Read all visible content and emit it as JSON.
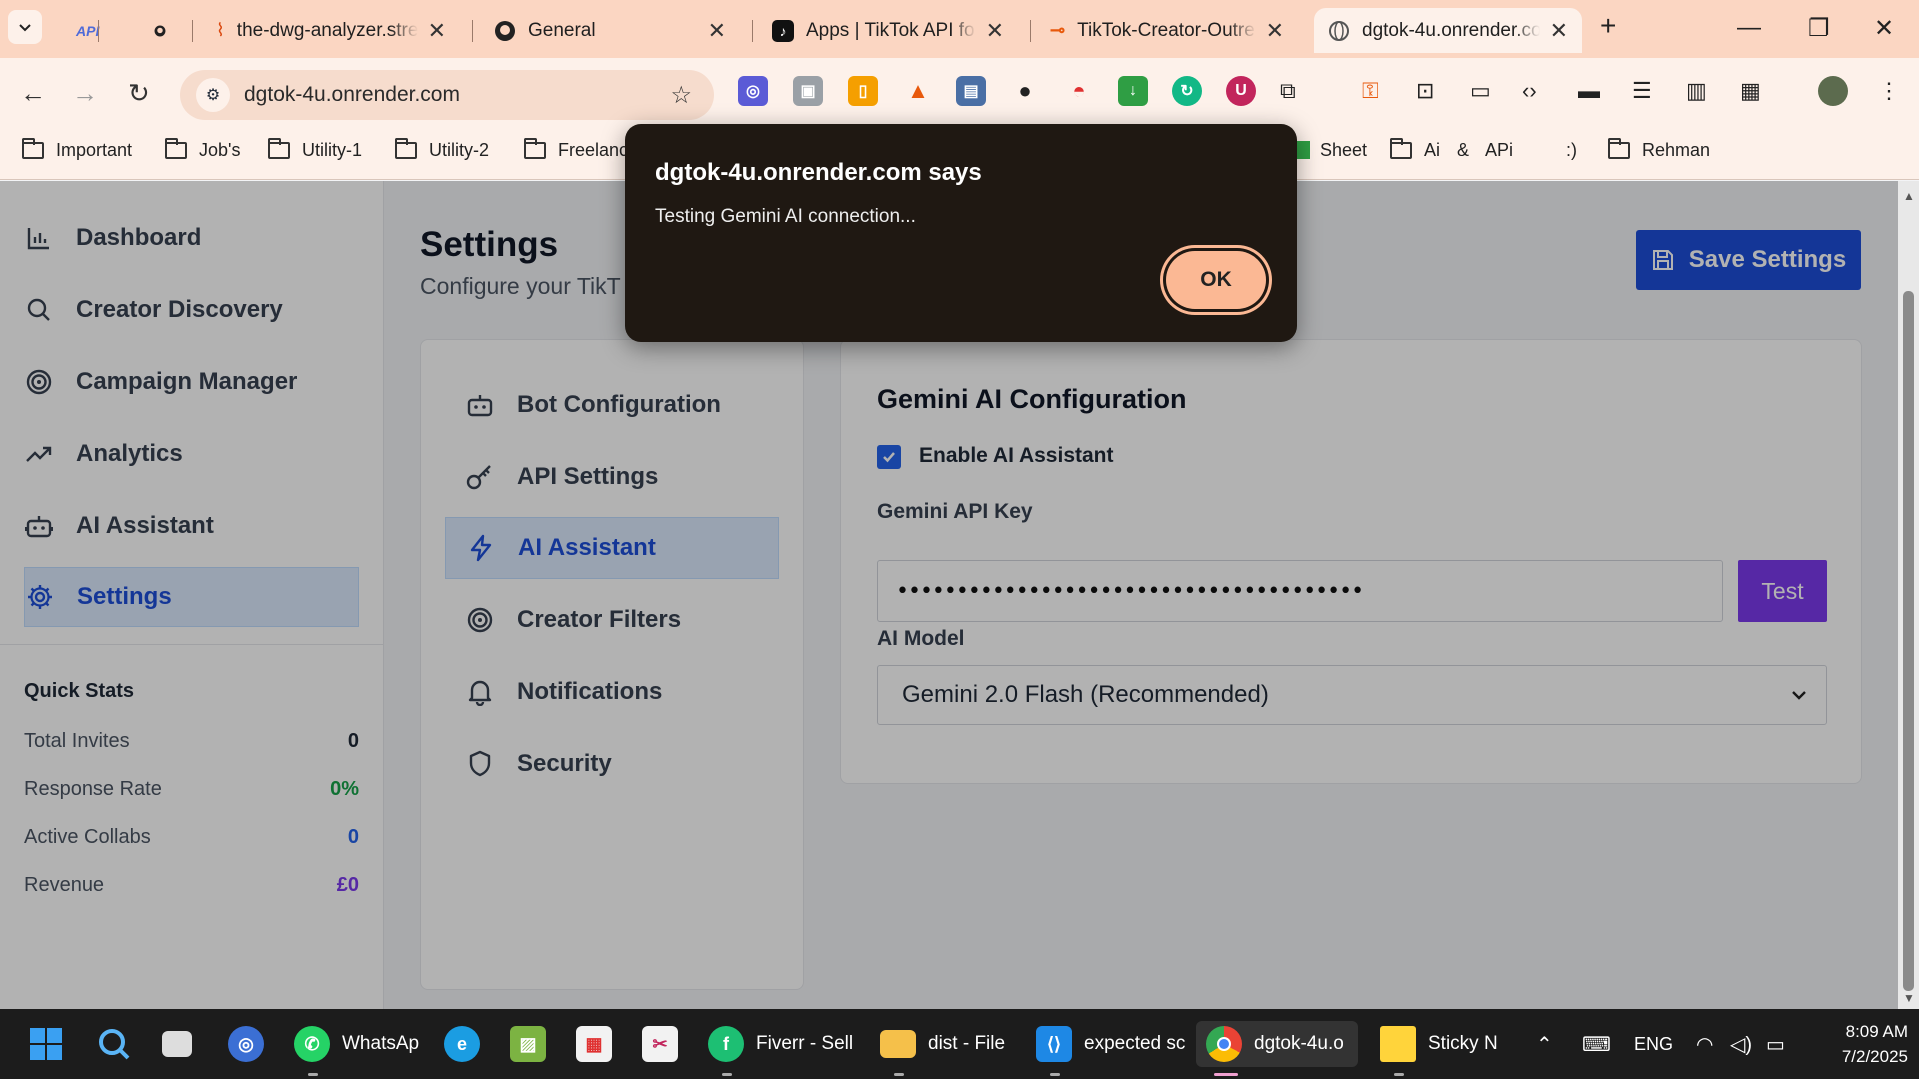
{
  "browser": {
    "tabs": [
      {
        "title": "API",
        "icon": "api-icon"
      },
      {
        "title": "",
        "icon": "github-icon"
      },
      {
        "title": "the-dwg-analyzer.stre",
        "icon": "streamlit-icon"
      },
      {
        "title": "General",
        "icon": "github-icon"
      },
      {
        "title": "Apps | TikTok API for |",
        "icon": "tiktok-icon"
      },
      {
        "title": "TikTok-Creator-Outre",
        "icon": "render-icon"
      },
      {
        "title": "dgtok-4u.onrender.co",
        "icon": "globe-icon"
      }
    ],
    "url": "dgtok-4u.onrender.com",
    "bookmarks": [
      "Important",
      "Job's",
      "Utility-1",
      "Utility-2",
      "Freelanc",
      "Sheet",
      "Ai & APi",
      ":)",
      "Rehman"
    ]
  },
  "sidebar": {
    "items": [
      {
        "label": "Dashboard",
        "icon": "bar-chart-icon"
      },
      {
        "label": "Creator Discovery",
        "icon": "search-icon"
      },
      {
        "label": "Campaign Manager",
        "icon": "target-icon"
      },
      {
        "label": "Analytics",
        "icon": "trending-up-icon"
      },
      {
        "label": "AI Assistant",
        "icon": "robot-icon"
      },
      {
        "label": "Settings",
        "icon": "gear-icon",
        "active": true
      }
    ],
    "quick_stats": {
      "title": "Quick Stats",
      "rows": [
        {
          "label": "Total Invites",
          "value": "0",
          "color": "#1f2937"
        },
        {
          "label": "Response Rate",
          "value": "0%",
          "color": "#16a34a"
        },
        {
          "label": "Active Collabs",
          "value": "0",
          "color": "#2563eb"
        },
        {
          "label": "Revenue",
          "value": "£0",
          "color": "#7c3aed"
        }
      ]
    }
  },
  "main": {
    "title": "Settings",
    "subtitle": "Configure your TikT",
    "save_label": "Save Settings"
  },
  "settings_nav": [
    {
      "label": "Bot Configuration",
      "icon": "robot-icon"
    },
    {
      "label": "API Settings",
      "icon": "key-icon"
    },
    {
      "label": "AI Assistant",
      "icon": "lightning-icon",
      "active": true
    },
    {
      "label": "Creator Filters",
      "icon": "target-icon"
    },
    {
      "label": "Notifications",
      "icon": "bell-icon"
    },
    {
      "label": "Security",
      "icon": "shield-icon"
    }
  ],
  "panel": {
    "title": "Gemini AI Configuration",
    "enable_label": "Enable AI Assistant",
    "enable_checked": true,
    "api_key_label": "Gemini API Key",
    "api_key_value": "•••••••••••••••••••••••••••••••••••••••",
    "test_label": "Test",
    "model_label": "AI Model",
    "model_value": "Gemini 2.0 Flash (Recommended)"
  },
  "dialog": {
    "title": "dgtok-4u.onrender.com says",
    "message": "Testing Gemini AI connection...",
    "ok_label": "OK"
  },
  "taskbar": {
    "apps": [
      {
        "label": "WhatsAp",
        "icon": "whatsapp-icon"
      },
      {
        "label": "Fiverr - Sell",
        "icon": "fiverr-icon"
      },
      {
        "label": "dist - File",
        "icon": "folder-icon"
      },
      {
        "label": "expected sc",
        "icon": "vscode-icon"
      },
      {
        "label": "dgtok-4u.o",
        "icon": "chrome-icon"
      },
      {
        "label": "Sticky N",
        "icon": "sticky-notes-icon"
      }
    ],
    "lang": "ENG",
    "time": "8:09 AM",
    "date": "7/2/2025"
  }
}
